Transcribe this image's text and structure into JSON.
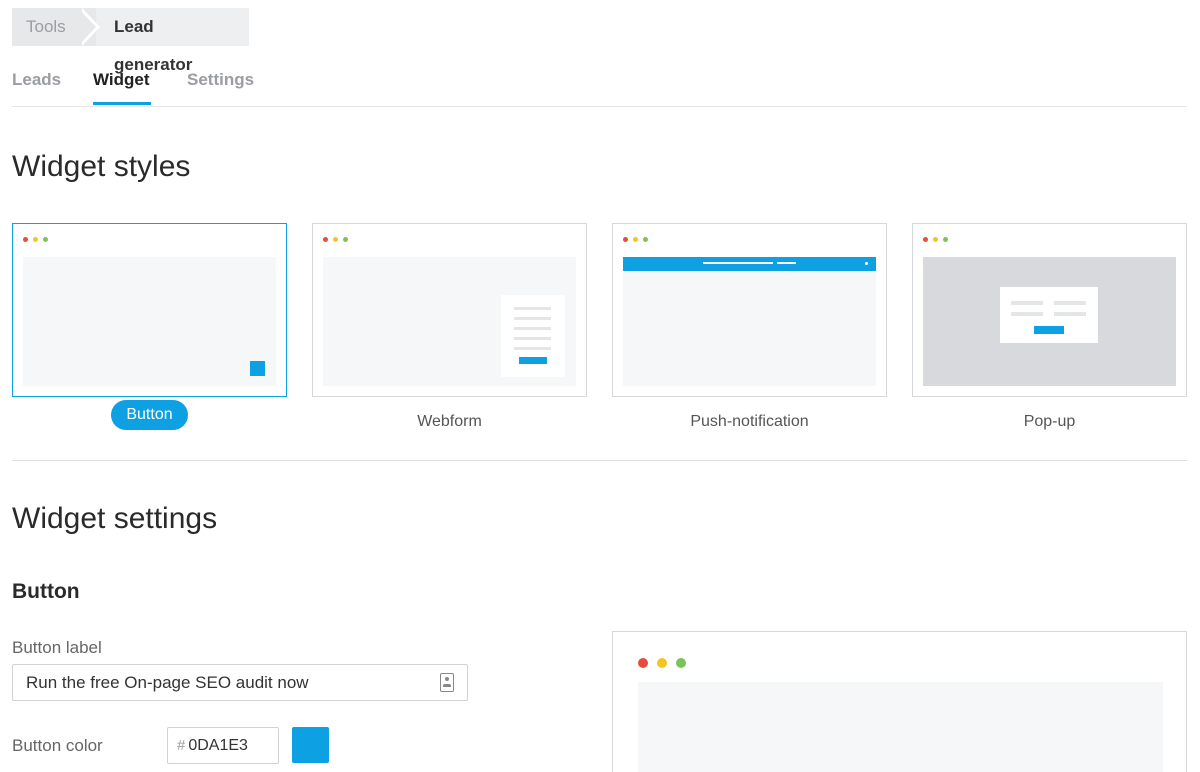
{
  "breadcrumb": {
    "root": "Tools",
    "current": "Lead generator"
  },
  "tabs": [
    {
      "label": "Leads",
      "active": false
    },
    {
      "label": "Widget",
      "active": true
    },
    {
      "label": "Settings",
      "active": false
    }
  ],
  "styles_section": {
    "title": "Widget styles",
    "cards": [
      {
        "label": "Button",
        "selected": true
      },
      {
        "label": "Webform",
        "selected": false
      },
      {
        "label": "Push-notification",
        "selected": false
      },
      {
        "label": "Pop-up",
        "selected": false
      }
    ]
  },
  "settings_section": {
    "title": "Widget settings",
    "subtitle": "Button",
    "button_label": {
      "label": "Button label",
      "value": "Run the free On-page SEO audit now"
    },
    "button_color": {
      "label": "Button color",
      "hash": "#",
      "value": "0DA1E3"
    }
  },
  "colors": {
    "accent": "#0da1e3",
    "dot_red": "#e84c3d",
    "dot_yellow": "#f4c521",
    "dot_green": "#7cc35c"
  },
  "icons": [
    "contact-card-icon"
  ]
}
